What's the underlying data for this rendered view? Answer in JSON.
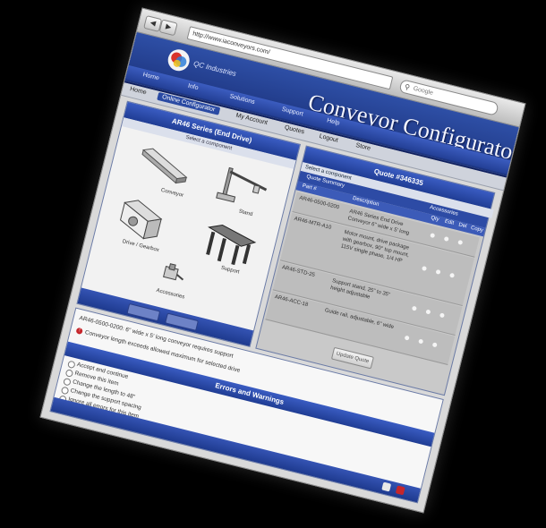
{
  "browser": {
    "url": "http://www.iaconveyors.com/",
    "search_placeholder": "Google",
    "tab_title": "Conveyor Configurator"
  },
  "header": {
    "brand": "QC Industries",
    "title": "Conveyor Configurator",
    "menu": [
      "Home",
      "Info",
      "Solutions",
      "Support",
      "Help"
    ]
  },
  "subnav": {
    "items": [
      "Home",
      "Online Configurator",
      "My Account",
      "Quotes",
      "Logout",
      "Store"
    ],
    "active": "Online Configurator"
  },
  "left_panel": {
    "title": "AR46 Series (End Drive)",
    "subtitle": "Select a component",
    "components": [
      "Conveyor",
      "Stand",
      "Drive / Gearbox",
      "Support",
      "Accessories"
    ]
  },
  "quote": {
    "title": "Quote #346335",
    "subtitle": "Select a component",
    "tabs": [
      "Quote Summary",
      "Accessories"
    ],
    "columns": [
      "Part #",
      "Description",
      "Qty",
      "Edit",
      "Del",
      "Copy"
    ],
    "rows": [
      {
        "part": "AR46-0500-0200",
        "desc": "AR46 Series End Drive Conveyor 6\" wide x 5' long"
      },
      {
        "part": "AR46-MTR-A10",
        "desc": "Motor mount, drive package with gearbox, 90° top mount, 115V single phase, 1/4 HP"
      },
      {
        "part": "AR46-STD-25",
        "desc": "Support stand, 25\" to 35\" height adjustable"
      },
      {
        "part": "AR46-ACC-18",
        "desc": "Guide rail, adjustable, 6\" wide"
      }
    ],
    "update_label": "Update Quote"
  },
  "errors": {
    "line1": "AR46-0500-0200: 6\" wide x 5' long conveyor requires support",
    "line2": "Conveyor length exceeds allowed maximum for selected drive",
    "title": "Errors and Warnings",
    "options": [
      "Accept and continue",
      "Remove this item",
      "Change the length to 48\"",
      "Change the support spacing",
      "Ignore all errors for this item"
    ]
  },
  "colors": {
    "brand_blue": "#2a4aa3",
    "error_red": "#c6262b"
  }
}
